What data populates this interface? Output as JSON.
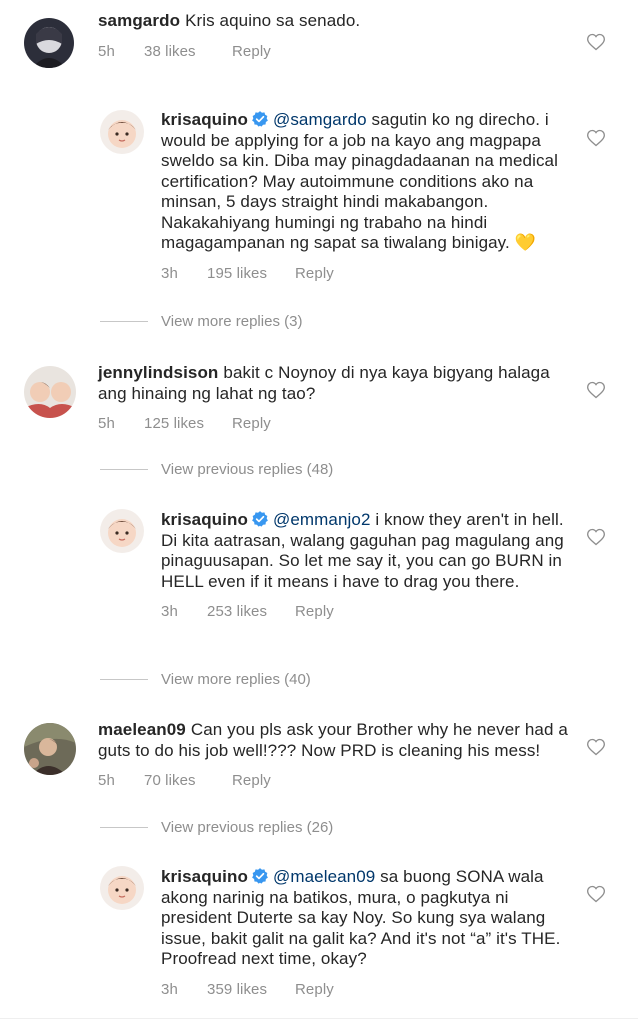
{
  "comments": [
    {
      "username": "samgardo",
      "verified": false,
      "segments": [
        {
          "type": "text",
          "value": "Kris aquino sa senado."
        }
      ],
      "time": "5h",
      "likes": "38 likes",
      "reply": "Reply",
      "avatar": "samgardo-avatar"
    },
    {
      "username": "krisaquino",
      "verified": true,
      "segments": [
        {
          "type": "mention",
          "value": "@samgardo"
        },
        {
          "type": "text",
          "value": " sagutin ko ng direcho. i would be applying for a job na kayo ang magpapa sweldo sa kin. Diba may pinagdadaanan na medical certification? May autoimmune conditions ako na minsan, 5 days straight hindi makabangon. Nakakahiyang humingi ng trabaho na hindi magagampanan ng sapat sa tiwalang binigay. "
        },
        {
          "type": "emoji",
          "value": "💛"
        }
      ],
      "time": "3h",
      "likes": "195 likes",
      "reply": "Reply",
      "avatar": "krisaquino-avatar"
    },
    {
      "username": "jennylindsison",
      "verified": false,
      "segments": [
        {
          "type": "text",
          "value": "bakit c Noynoy di nya kaya bigyang halaga ang hinaing ng lahat ng tao?"
        }
      ],
      "time": "5h",
      "likes": "125 likes",
      "reply": "Reply",
      "avatar": "jennylindsison-avatar"
    },
    {
      "username": "krisaquino",
      "verified": true,
      "segments": [
        {
          "type": "mention",
          "value": "@emmanjo2"
        },
        {
          "type": "text",
          "value": " i know they aren't in hell. Di kita aatrasan, walang gaguhan pag magulang ang pinaguusapan. So let me say it, you can go BURN in HELL even if it means i have to drag you there."
        }
      ],
      "time": "3h",
      "likes": "253 likes",
      "reply": "Reply",
      "avatar": "krisaquino-avatar"
    },
    {
      "username": "maelean09",
      "verified": false,
      "segments": [
        {
          "type": "text",
          "value": "Can you pls ask your Brother why he never had a guts to do his job well!??? Now PRD is cleaning his mess!"
        }
      ],
      "time": "5h",
      "likes": "70 likes",
      "reply": "Reply",
      "avatar": "maelean09-avatar"
    },
    {
      "username": "krisaquino",
      "verified": true,
      "segments": [
        {
          "type": "mention",
          "value": "@maelean09"
        },
        {
          "type": "text",
          "value": " sa buong SONA wala akong narinig na batikos, mura, o pagkutya ni president Duterte sa kay Noy. So kung sya walang issue, bakit galit na galit ka? And it's not “a” it's THE. Proofread next time, okay?"
        }
      ],
      "time": "3h",
      "likes": "359 likes",
      "reply": "Reply",
      "avatar": "krisaquino-avatar"
    }
  ],
  "reply_toggles": [
    {
      "label": "View more replies (3)"
    },
    {
      "label": "View previous replies (48)"
    },
    {
      "label": "View more replies (40)"
    },
    {
      "label": "View previous replies (26)"
    }
  ],
  "colors": {
    "text": "#262626",
    "meta": "#8e8e8e",
    "mention": "#00376b",
    "verified": "#3897f0"
  }
}
